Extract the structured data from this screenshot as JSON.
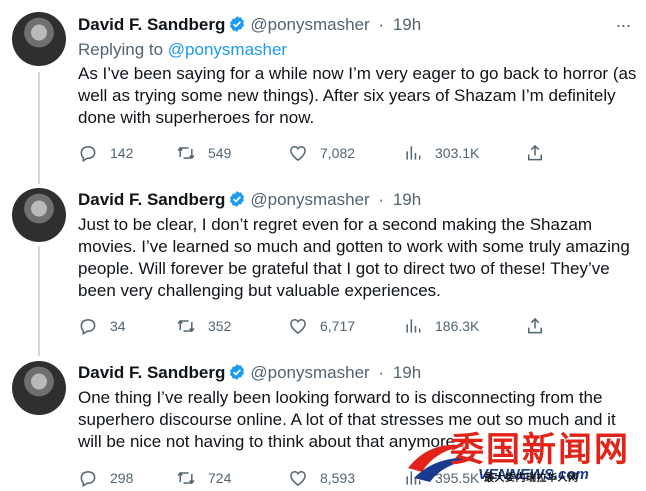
{
  "tweets": [
    {
      "name": "David F. Sandberg",
      "handle": "@ponysmasher",
      "dot": "·",
      "time": "19h",
      "more": "···",
      "replying_label": "Replying to ",
      "replying_to": "@ponysmasher",
      "text": "As I’ve been saying for a while now I’m very eager to go back to horror (as well as trying some new things). After six years of Shazam I’m definitely done with superheroes for now.",
      "replies": "142",
      "retweets": "549",
      "likes": "7,082",
      "views": "303.1K"
    },
    {
      "name": "David F. Sandberg",
      "handle": "@ponysmasher",
      "dot": "·",
      "time": "19h",
      "text": "Just to be clear, I don’t regret even for a second making the Shazam movies. I’ve learned so much and gotten to work with some truly amazing people. Will forever be grateful that I got to direct two of these! They’ve been very challenging but valuable experiences.",
      "replies": "34",
      "retweets": "352",
      "likes": "6,717",
      "views": "186.3K"
    },
    {
      "name": "David F. Sandberg",
      "handle": "@ponysmasher",
      "dot": "·",
      "time": "19h",
      "text": "One thing I’ve really been looking forward to is disconnecting from the superhero discourse online. A lot of that stresses me out so much and it will be nice not having to think about that anymore.",
      "replies": "298",
      "retweets": "724",
      "likes": "8,593",
      "views": "395.5K"
    }
  ],
  "watermark": {
    "title": "委国新闻网",
    "site": "VENNEWS.com",
    "subtitle": "最大委内瑞拉华人网"
  },
  "colors": {
    "accent": "#1d9bf0",
    "muted": "#536471",
    "text": "#0f1419",
    "watermark_red": "#e2231a"
  }
}
